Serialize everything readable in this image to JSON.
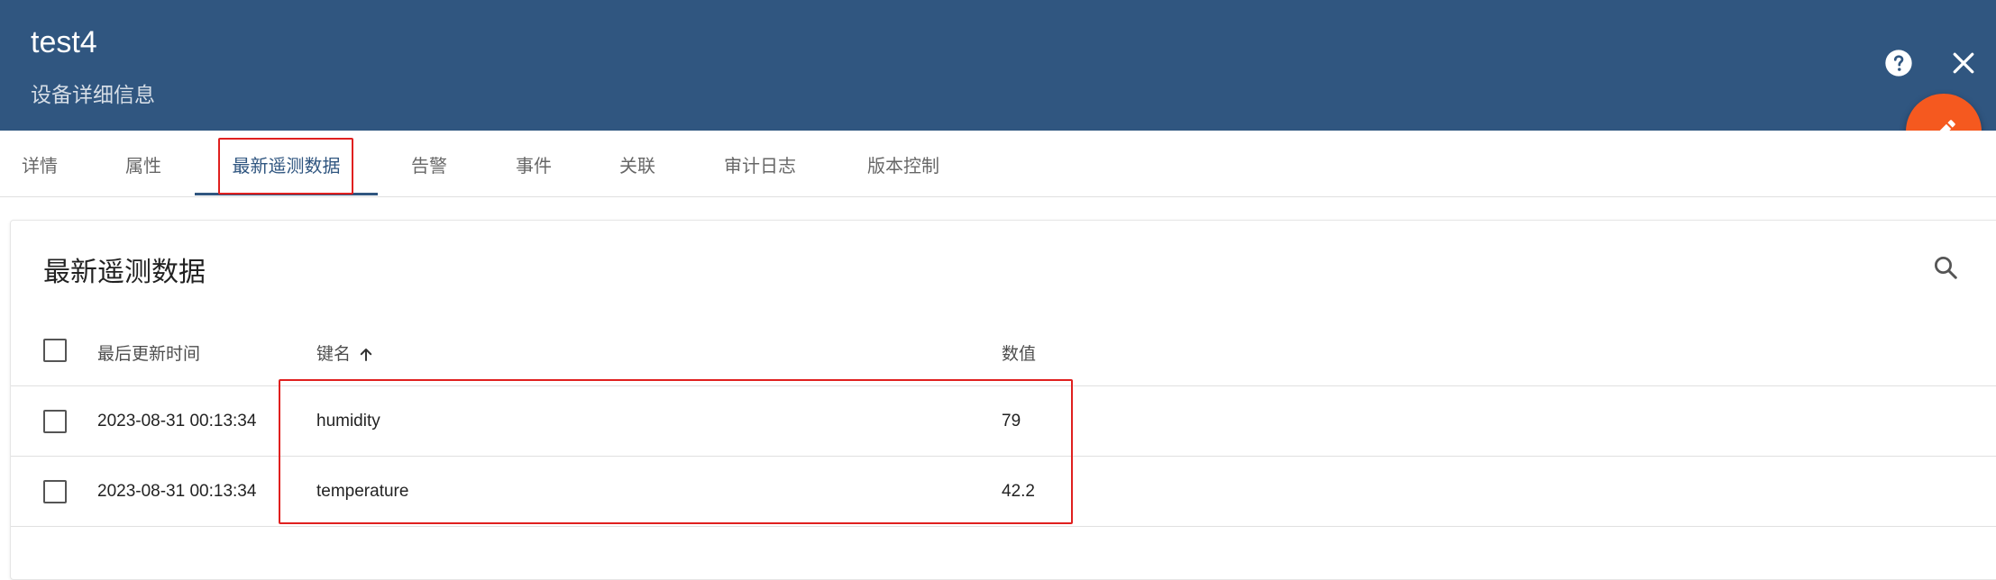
{
  "header": {
    "title": "test4",
    "subtitle": "设备详细信息",
    "help_icon": "help-circle-icon",
    "close_icon": "close-icon",
    "edit_icon": "pencil-icon",
    "background_color": "#305680",
    "fab_color": "#f5591f"
  },
  "tabs": [
    {
      "label": "详情"
    },
    {
      "label": "属性"
    },
    {
      "label": "最新遥测数据",
      "active": true
    },
    {
      "label": "告警"
    },
    {
      "label": "事件"
    },
    {
      "label": "关联"
    },
    {
      "label": "审计日志"
    },
    {
      "label": "版本控制"
    }
  ],
  "card": {
    "title": "最新遥测数据",
    "search_icon": "search-icon"
  },
  "table": {
    "columns": [
      "最后更新时间",
      "键名",
      "数值"
    ],
    "sort_icon": "arrow-up-icon",
    "rows": [
      {
        "time": "2023-08-31 00:13:34",
        "key": "humidity",
        "value": "79"
      },
      {
        "time": "2023-08-31 00:13:34",
        "key": "temperature",
        "value": "42.2"
      }
    ]
  },
  "highlight_color": "#e0201f"
}
